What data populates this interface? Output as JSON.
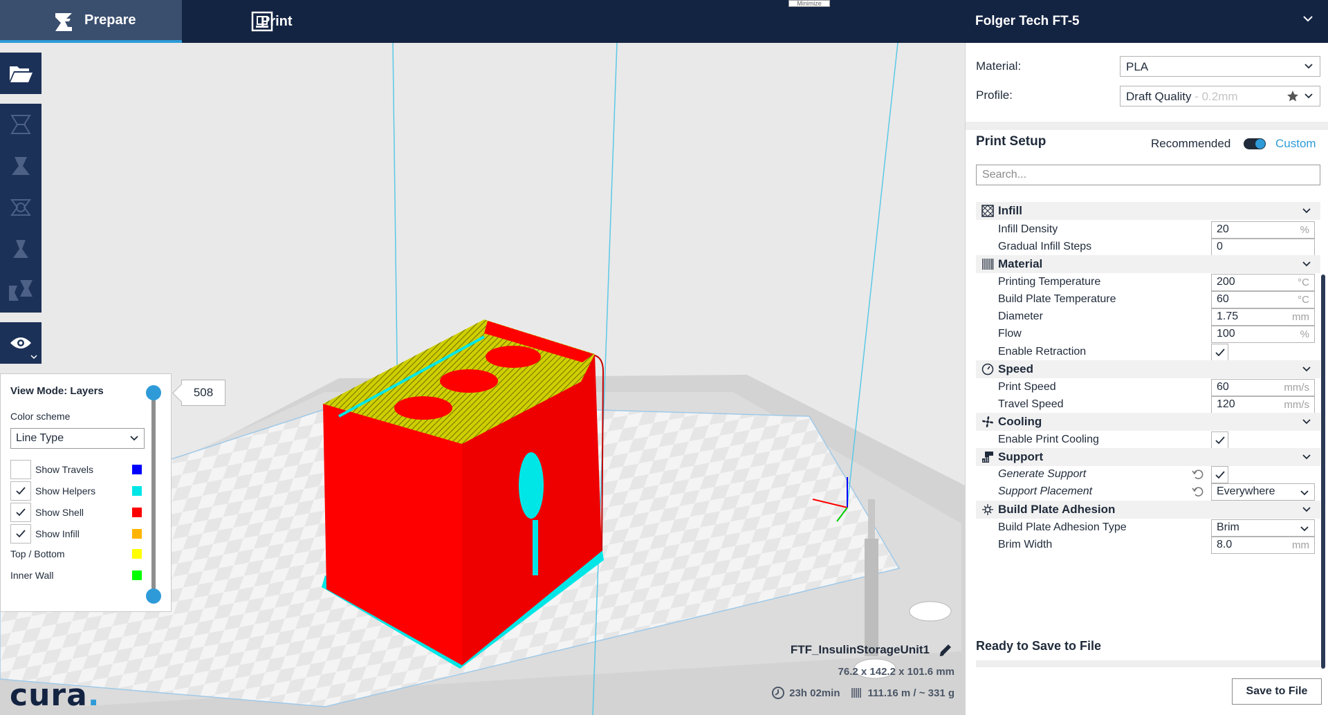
{
  "topbar": {
    "tabs": [
      {
        "label": "Prepare",
        "icon": "prepare-icon",
        "active": true
      },
      {
        "label": "Print",
        "icon": "monitor-icon",
        "active": false
      }
    ],
    "tooltip": "Minimize",
    "printer": "Folger Tech FT-5"
  },
  "layer_panel": {
    "title": "View Mode: Layers",
    "color_scheme_label": "Color scheme",
    "color_scheme_value": "Line Type",
    "current_layer": "508",
    "rows": [
      {
        "label": "Show Travels",
        "checked": false,
        "color": "#0000ff"
      },
      {
        "label": "Show Helpers",
        "checked": true,
        "color": "#00e6e6"
      },
      {
        "label": "Show Shell",
        "checked": true,
        "color": "#ff0000"
      },
      {
        "label": "Show Infill",
        "checked": true,
        "color": "#ffb400"
      },
      {
        "label": "Top / Bottom",
        "checked": null,
        "color": "#ffff00"
      },
      {
        "label": "Inner Wall",
        "checked": null,
        "color": "#00ff00"
      }
    ]
  },
  "logo": {
    "text": "cura",
    "dot": "."
  },
  "job": {
    "name": "FTF_InsulinStorageUnit1",
    "dimensions": "76.2 x 142.2 x 101.6 mm",
    "time": "23h 02min",
    "material_usage": "111.16 m / ~ 331 g"
  },
  "sidebar": {
    "material_label": "Material:",
    "material_value": "PLA",
    "profile_label": "Profile:",
    "profile_value": "Draft Quality",
    "profile_layer": " - 0.2mm",
    "setup_title": "Print Setup",
    "mode_recommended": "Recommended",
    "mode_custom": "Custom",
    "search_placeholder": "Search...",
    "categories": {
      "infill": "Infill",
      "material": "Material",
      "speed": "Speed",
      "cooling": "Cooling",
      "support": "Support",
      "adhesion": "Build Plate Adhesion"
    },
    "settings": {
      "infill_density": {
        "label": "Infill Density",
        "value": "20",
        "unit": "%"
      },
      "gradual_infill": {
        "label": "Gradual Infill Steps",
        "value": "0",
        "unit": ""
      },
      "print_temp": {
        "label": "Printing Temperature",
        "value": "200",
        "unit": "°C"
      },
      "bed_temp": {
        "label": "Build Plate Temperature",
        "value": "60",
        "unit": "°C"
      },
      "diameter": {
        "label": "Diameter",
        "value": "1.75",
        "unit": "mm"
      },
      "flow": {
        "label": "Flow",
        "value": "100",
        "unit": "%"
      },
      "retraction": {
        "label": "Enable Retraction",
        "checked": true
      },
      "print_speed": {
        "label": "Print Speed",
        "value": "60",
        "unit": "mm/s"
      },
      "travel_speed": {
        "label": "Travel Speed",
        "value": "120",
        "unit": "mm/s"
      },
      "print_cooling": {
        "label": "Enable Print Cooling",
        "checked": true
      },
      "gen_support": {
        "label": "Generate Support",
        "checked": true
      },
      "support_place": {
        "label": "Support Placement",
        "value": "Everywhere"
      },
      "adhesion_type": {
        "label": "Build Plate Adhesion Type",
        "value": "Brim"
      },
      "brim_width": {
        "label": "Brim Width",
        "value": "8.0",
        "unit": "mm"
      }
    },
    "ready_title": "Ready to Save to File",
    "save_button": "Save to File"
  },
  "colors": {
    "topbar": "#132342",
    "accent": "#2e9bd8",
    "shell": "#ff0000",
    "helpers": "#00e6e6",
    "top_bottom": "#b4b400"
  }
}
